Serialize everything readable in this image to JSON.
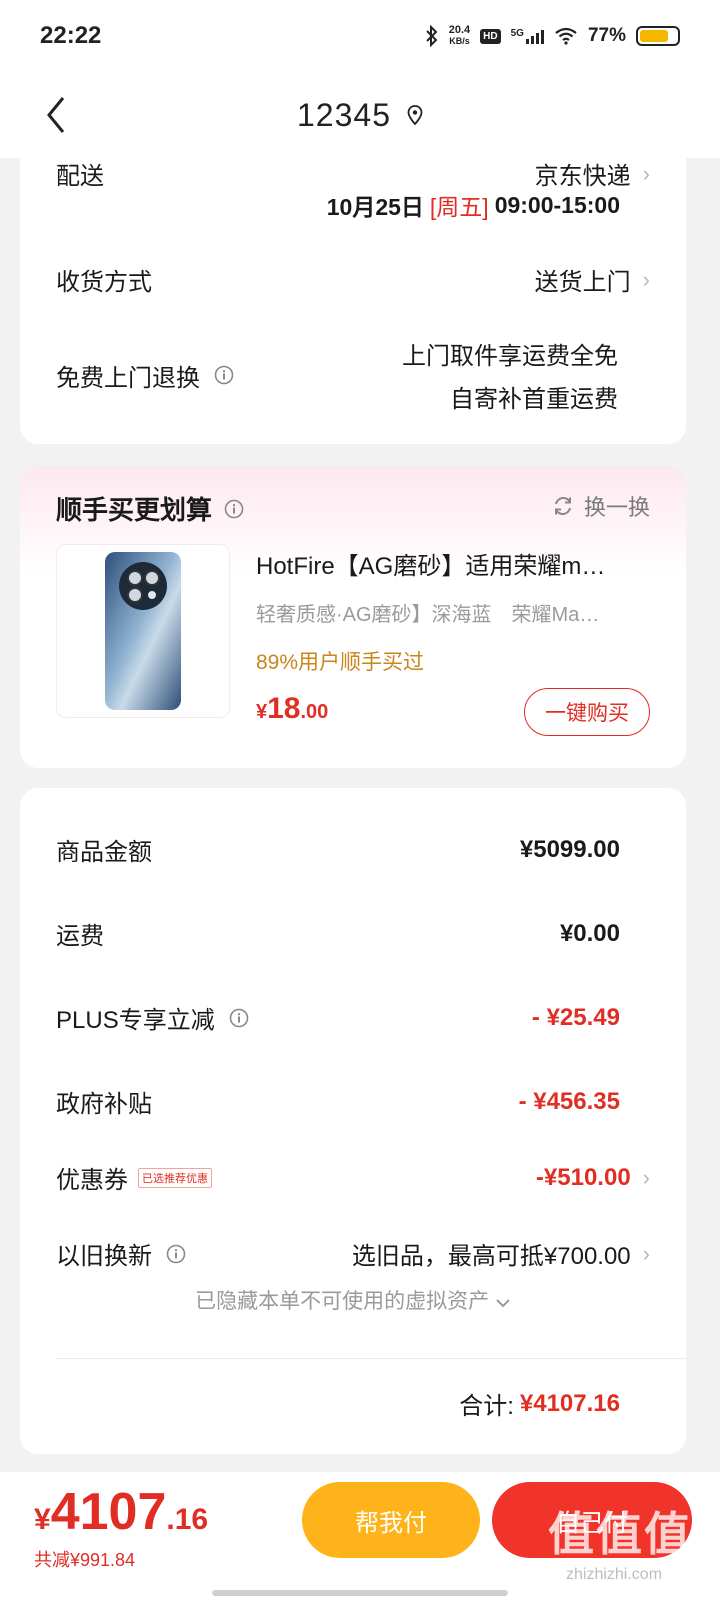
{
  "status_bar": {
    "time": "22:22",
    "net_speed_value": "20.4",
    "net_speed_unit": "KB/s",
    "hd": "HD",
    "network": "5G",
    "battery": "77%"
  },
  "nav": {
    "title": "12345"
  },
  "delivery_card": {
    "shipping_label": "配送",
    "shipping_value": "京东快递",
    "schedule_date": "10月25日",
    "schedule_weekday": "[周五]",
    "schedule_time": "09:00-15:00",
    "receive_label": "收货方式",
    "receive_value": "送货上门",
    "return_label": "免费上门退换",
    "return_line1": "上门取件享运费全免",
    "return_line2": "自寄补首重运费"
  },
  "recommend": {
    "title": "顺手买更划算",
    "refresh_label": "换一换",
    "product_name": "HotFire【AG磨砂】适用荣耀m…",
    "product_spec": "轻奢质感·AG磨砂】深海蓝　荣耀Ma…",
    "product_stat": "89%用户顺手买过",
    "price_symbol": "¥",
    "price_int": "18",
    "price_dec": ".00",
    "buy_label": "一键购买"
  },
  "summary": {
    "goods_label": "商品金额",
    "goods_value": "¥5099.00",
    "freight_label": "运费",
    "freight_value": "¥0.00",
    "plus_label": "PLUS专享立减",
    "plus_value": "- ¥25.49",
    "subsidy_label": "政府补贴",
    "subsidy_value": "- ¥456.35",
    "coupon_label": "优惠券",
    "coupon_badge": "已选推荐优惠",
    "coupon_value": "-¥510.00",
    "tradein_label": "以旧换新",
    "tradein_value": "选旧品，最高可抵¥700.00",
    "hidden_assets": "已隐藏本单不可使用的虚拟资产",
    "total_label": "合计:",
    "total_value": "¥4107.16"
  },
  "bottom": {
    "price_symbol": "¥",
    "price_int": "4107",
    "price_dec": ".16",
    "saved": "共减¥991.84",
    "help_pay": "帮我付",
    "self_pay": "自己付",
    "watermark": "值值值",
    "watermark_url": "zhizhizhi.com"
  },
  "colors": {
    "accent_red": "#e02e24",
    "help_button": "#ffb31a",
    "pay_button": "#f1342a",
    "stat_orange": "#c9861d"
  }
}
